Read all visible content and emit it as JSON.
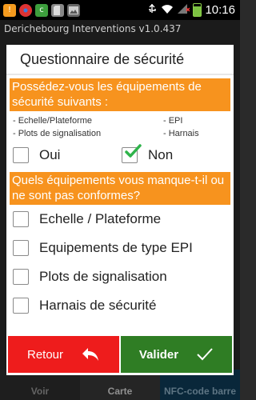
{
  "status_bar": {
    "time": "10:16",
    "icons": [
      "alert-icon",
      "chrome-icon",
      "cafe-icon",
      "sd-card-icon",
      "image-icon",
      "usb-icon",
      "wifi-icon",
      "no-signal-icon",
      "battery-icon"
    ]
  },
  "app": {
    "title": "Derichebourg Interventions v1.0.437"
  },
  "dialog": {
    "title": "Questionnaire de sécurité",
    "question1": {
      "text": "Possédez-vous les équipements de sécurité suivants :",
      "items_left": [
        "- Echelle/Plateforme",
        "- Plots de signalisation"
      ],
      "items_right": [
        "- EPI",
        "- Harnais"
      ],
      "options": [
        {
          "label": "Oui",
          "checked": false
        },
        {
          "label": "Non",
          "checked": true
        }
      ]
    },
    "question2": {
      "text": "Quels équipements vous manque-t-il ou ne sont pas conformes?",
      "options": [
        {
          "label": "Echelle / Plateforme",
          "checked": false
        },
        {
          "label": "Equipements de type EPI",
          "checked": false
        },
        {
          "label": "Plots de signalisation",
          "checked": false
        },
        {
          "label": "Harnais de sécurité",
          "checked": false
        }
      ]
    },
    "buttons": {
      "retour": "Retour",
      "valider": "Valider"
    }
  },
  "bottom_bar": {
    "items": [
      "Voir",
      "Carte",
      "NFC-code barre"
    ]
  },
  "colors": {
    "accent_orange": "#f7931e",
    "retour_red": "#ee1c1c",
    "valider_green": "#2f7d24",
    "check_green": "#2eb34a"
  }
}
